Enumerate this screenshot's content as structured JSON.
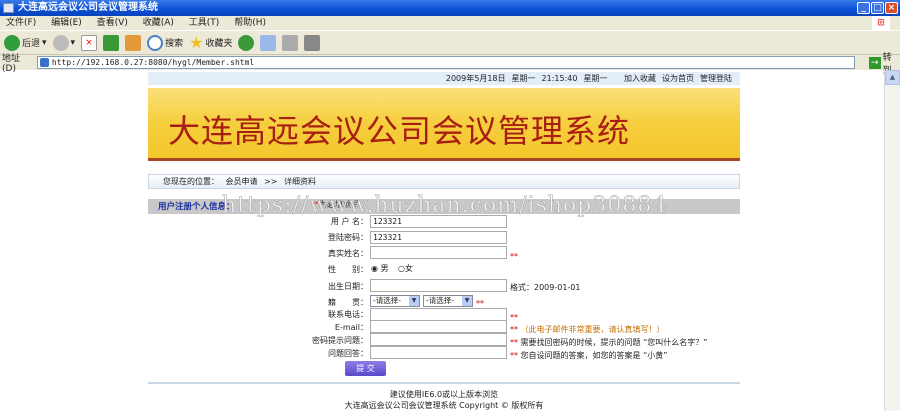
{
  "window": {
    "title": "大连高远会议公司会议管理系统"
  },
  "menu": [
    "文件(F)",
    "编辑(E)",
    "查看(V)",
    "收藏(A)",
    "工具(T)",
    "帮助(H)"
  ],
  "toolbar": {
    "back": "后退",
    "search": "搜索",
    "favorites": "收藏夹"
  },
  "address": {
    "label": "地址(D)",
    "url": "http://192.168.0.27:8080/hygl/Member.shtml",
    "go": "转到"
  },
  "topbar": {
    "date": "2009年5月18日",
    "weekday": "星期一",
    "time": "21:15:40",
    "weekday2": "星期一",
    "links": [
      "加入收藏",
      "设为首页",
      "管理登陆"
    ]
  },
  "banner": {
    "title": "大连高远会议公司会议管理系统"
  },
  "breadcrumb": {
    "prefix": "您现在的位置：",
    "items": [
      "会员申请",
      ">>",
      "详细资料"
    ]
  },
  "section": {
    "title": "用户注册个人信息：",
    "required_mark": "**",
    "required_text": "为必填项目"
  },
  "watermark": "https://www.huzhan.com/ishop30884",
  "form": {
    "username": {
      "label": "用 户 名：",
      "value": "123321"
    },
    "password": {
      "label": "登陆密码：",
      "value": "123321"
    },
    "realname": {
      "label": "真实姓名：",
      "value": "",
      "mark": "**"
    },
    "gender": {
      "label": "性　　别：",
      "options": [
        "男",
        "女"
      ],
      "selected": "男"
    },
    "birthday": {
      "label": "出生日期：",
      "value": "",
      "hint": "格式：2009-01-01"
    },
    "origin": {
      "label": "籍　　贯：",
      "select1": "-请选择-",
      "select2": "-请选择-",
      "mark": "**"
    },
    "phone": {
      "label": "联系电话：",
      "value": "",
      "mark": "**"
    },
    "email": {
      "label": "E-mail：",
      "value": "",
      "mark": "**",
      "hint": "（此电子邮件非常重要，请认真填写！）"
    },
    "question": {
      "label": "密码提示问题：",
      "value": "",
      "mark": "**",
      "hint": "需要找回密码的时候，提示的问题 “您叫什么名字？”"
    },
    "answer": {
      "label": "问题回答：",
      "value": "",
      "mark": "**",
      "hint": "您自设问题的答案，如您的答案是 “小黄”"
    },
    "submit": "提 交"
  },
  "footer": {
    "line1": "建议使用IE6.0或以上版本浏览",
    "line2": "大连高远会议公司会议管理系统 Copyright © 版权所有"
  }
}
